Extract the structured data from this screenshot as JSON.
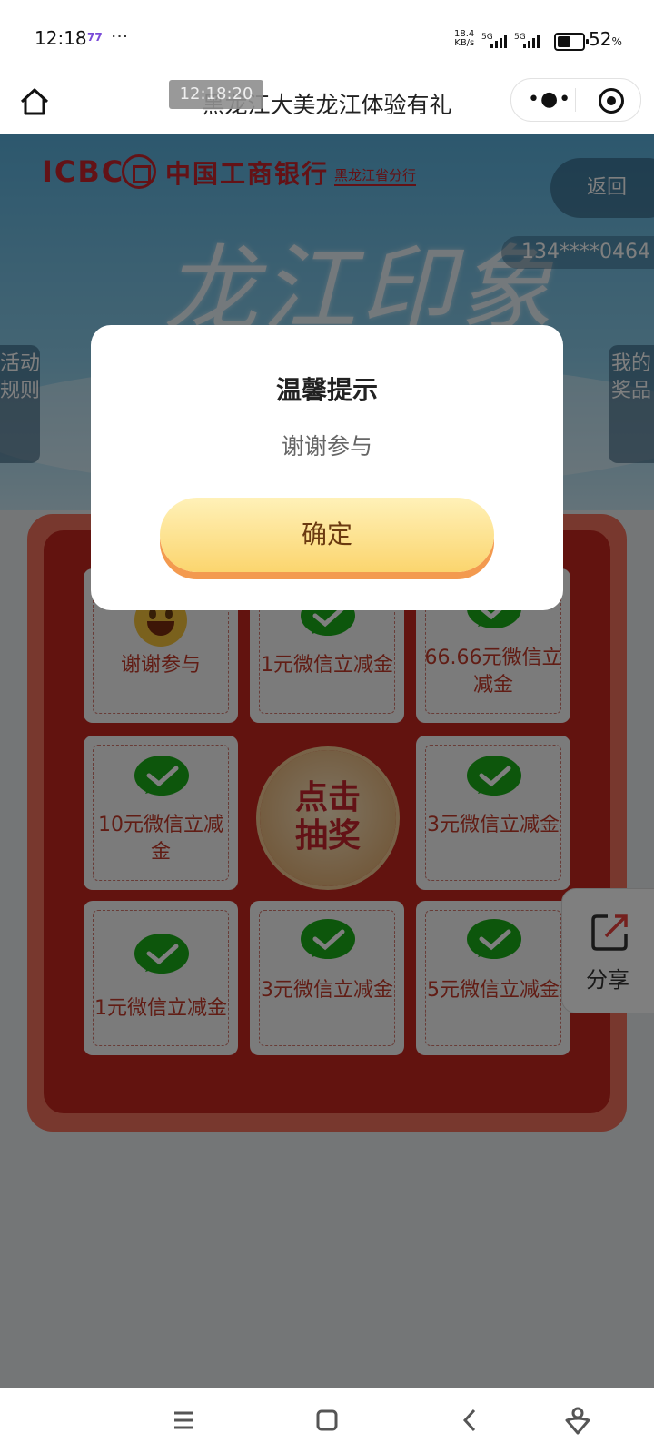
{
  "status_bar": {
    "time": "12:18",
    "notification_badge": "77",
    "more": "···",
    "net_speed_value": "18.4",
    "net_speed_unit": "KB/s",
    "sig1_label": "5G",
    "sig2_label": "5G",
    "battery_level": 0.52,
    "battery_value": "52",
    "battery_unit": "%"
  },
  "title_bar": {
    "title": "黑龙江大美龙江体验有礼",
    "toast_time": "12:18:20"
  },
  "banner": {
    "logo_text": "ICBC",
    "bank_name": "中国工商银行",
    "branch": "黑龙江省分行",
    "headline": "龙江印象",
    "back_label": "返回",
    "phone": "134****0464",
    "rules_tab": "活动规则",
    "prizes_tab": "我的奖品"
  },
  "lottery": {
    "cells": [
      {
        "label": "谢谢参与",
        "icon": "smiley-icon"
      },
      {
        "label": "1元微信立减金",
        "icon": "wechat-icon"
      },
      {
        "label": "66.66元微信立减金",
        "icon": "wechat-icon"
      },
      {
        "label": "10元微信立减金",
        "icon": "wechat-icon"
      },
      {
        "label": "3元微信立减金",
        "icon": "wechat-icon"
      },
      {
        "label": "1元微信立减金",
        "icon": "wechat-icon"
      },
      {
        "label": "3元微信立减金",
        "icon": "wechat-icon"
      },
      {
        "label": "5元微信立减金",
        "icon": "wechat-icon"
      }
    ],
    "draw_line1": "点击",
    "draw_line2": "抽奖"
  },
  "share": {
    "label": "分享",
    "icon": "share-icon"
  },
  "modal": {
    "title": "温馨提示",
    "message": "谢谢参与",
    "confirm": "确定"
  },
  "nav_bar": {
    "menu_icon": "menu-icon",
    "home_icon": "home-square-icon",
    "back_icon": "back-chevron-icon",
    "assistant_icon": "assistant-icon"
  },
  "colors": {
    "icbc_red": "#c6252c",
    "wechat_green": "#1aad19",
    "board_red": "#c4261e",
    "button_gold": "#fbd56e"
  }
}
